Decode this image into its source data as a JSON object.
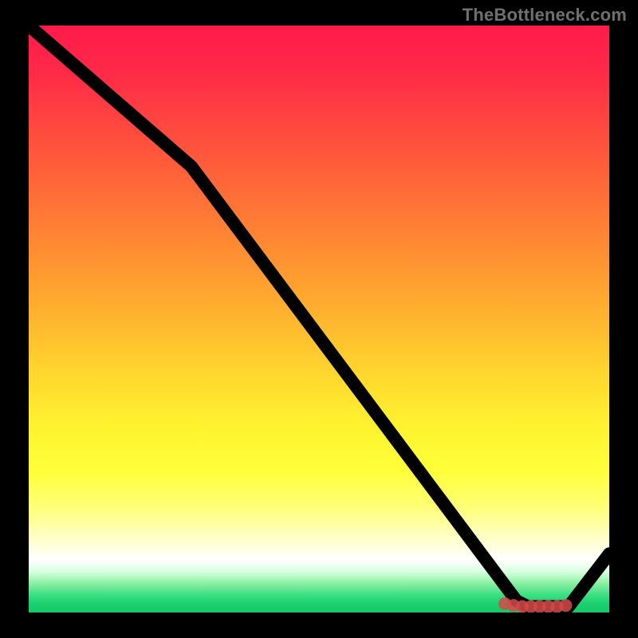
{
  "watermark": "TheBottleneck.com",
  "chart_data": {
    "type": "line",
    "title": "",
    "xlabel": "",
    "ylabel": "",
    "xlim": [
      0,
      100
    ],
    "ylim": [
      0,
      100
    ],
    "background_gradient": {
      "top": "#ff1a4b",
      "bottom": "#17c968",
      "note": "red → orange → yellow → white → green, top to bottom"
    },
    "series": [
      {
        "name": "curve",
        "x": [
          0,
          28,
          84,
          86,
          93,
          100
        ],
        "y": [
          100,
          76,
          2,
          1,
          1,
          10
        ]
      }
    ],
    "markers": {
      "name": "highlighted-segment",
      "x": [
        82,
        83.5,
        85,
        86.5,
        88,
        89.5,
        91,
        92.5
      ],
      "y": [
        1.5,
        1.2,
        1.0,
        1.0,
        1.0,
        1.0,
        1.0,
        1.2
      ],
      "r": 1.1
    }
  }
}
